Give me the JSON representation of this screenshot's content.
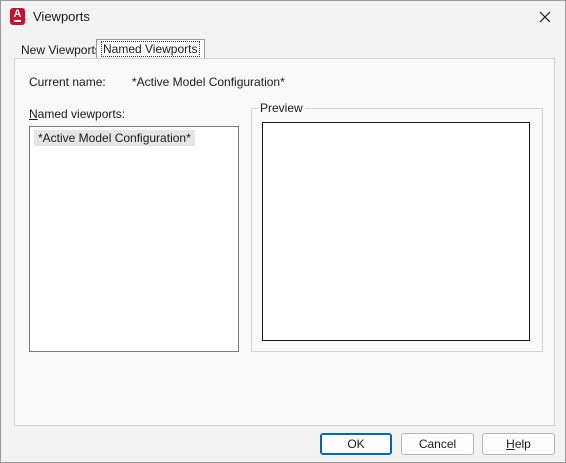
{
  "window": {
    "title": "Viewports",
    "icon": "autocad-app-icon",
    "icon_letter": "A",
    "accent": "#c8102e"
  },
  "tabs": [
    {
      "label": "New Viewports",
      "active": false
    },
    {
      "label": "Named Viewports",
      "active": true
    }
  ],
  "current": {
    "label": "Current name:",
    "value": "*Active Model Configuration*"
  },
  "named_viewports": {
    "label_hotkey": "N",
    "label_rest": "amed viewports:",
    "items": [
      "*Active Model Configuration*"
    ]
  },
  "preview": {
    "label": "Preview"
  },
  "buttons": {
    "ok": "OK",
    "cancel": "Cancel",
    "help_hotkey": "H",
    "help_rest": "elp"
  }
}
